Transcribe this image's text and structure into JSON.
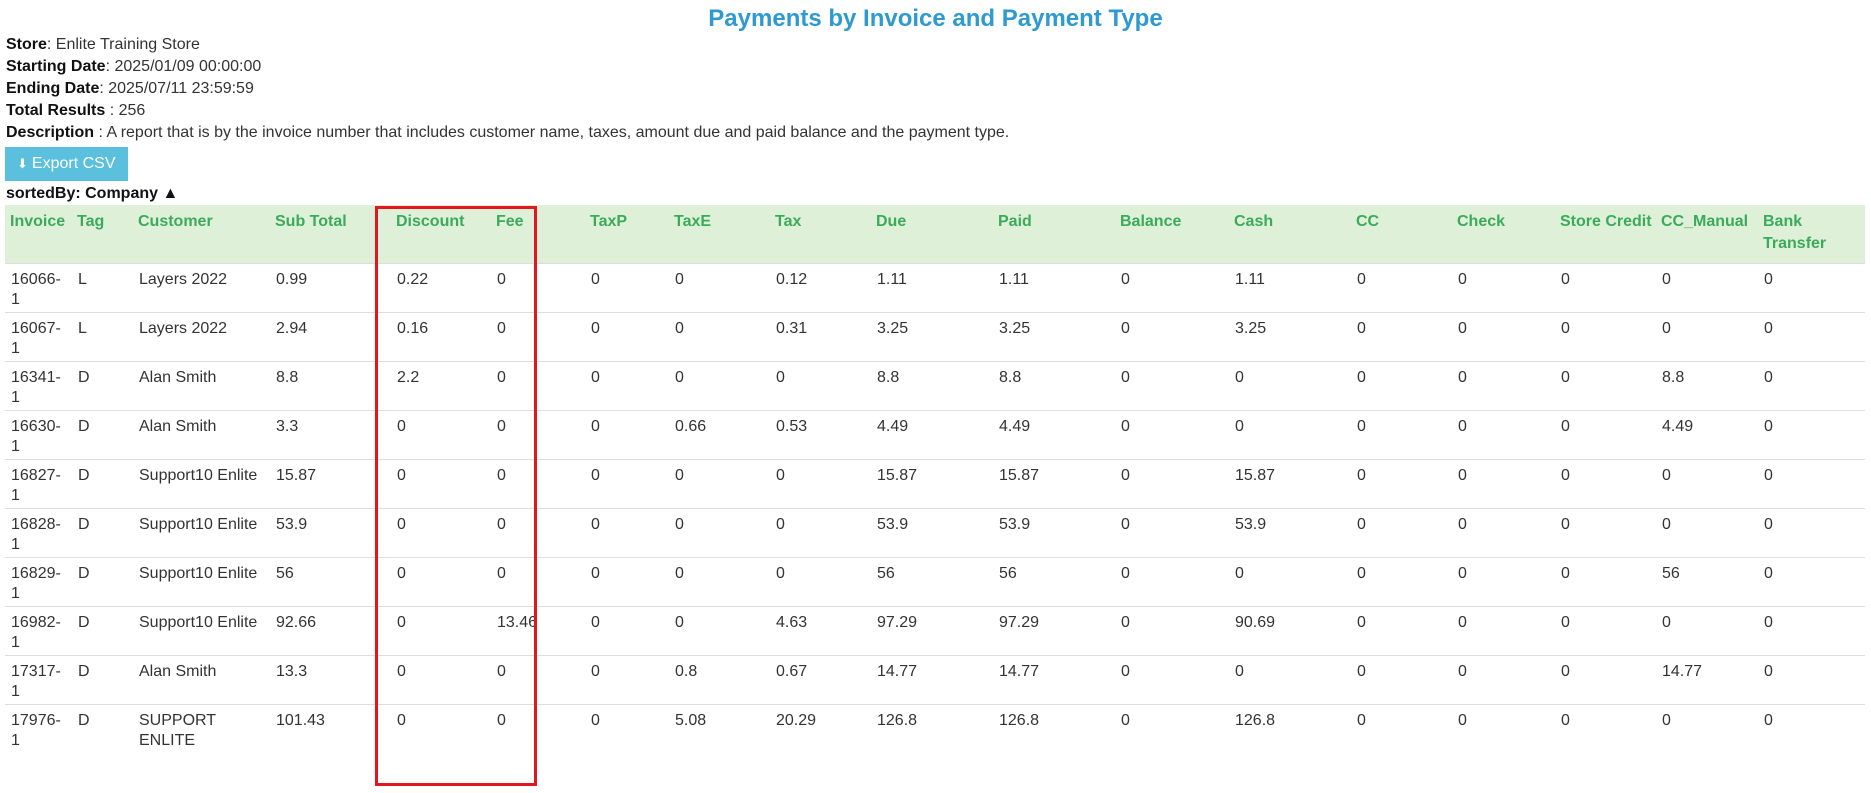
{
  "report": {
    "title": "Payments by Invoice and Payment Type",
    "store_label": "Store",
    "store_value": ": Enlite Training Store",
    "start_label": "Starting Date",
    "start_value": ": 2025/01/09 00:00:00",
    "end_label": "Ending Date",
    "end_value": ": 2025/07/11 23:59:59",
    "total_label": "Total Results",
    "total_value": " : 256",
    "desc_label": "Description",
    "desc_value": " : A report that is by the invoice number that includes customer name, taxes, amount due and paid balance and the payment type.",
    "export_label": "Export CSV",
    "export_icon": "download-icon",
    "sorted_by": "sortedBy: Company ▲"
  },
  "colors": {
    "title": "#2e9ad0",
    "header_bg": "#dff0d8",
    "header_text": "#3aab5b",
    "button": "#5bc0de",
    "highlight": "#e3151f"
  },
  "table": {
    "columns": [
      "Invoice",
      "Tag",
      "Customer",
      "Sub Total",
      "Discount",
      "Fee",
      "TaxP",
      "TaxE",
      "Tax",
      "Due",
      "Paid",
      "Balance",
      "Cash",
      "CC",
      "Check",
      "Store Credit",
      "CC_Manual",
      "Bank Transfer"
    ],
    "rows": [
      [
        "16066-1",
        "L",
        "Layers 2022",
        "0.99",
        "0.22",
        "0",
        "0",
        "0",
        "0.12",
        "1.11",
        "1.11",
        "0",
        "1.11",
        "0",
        "0",
        "0",
        "0",
        "0"
      ],
      [
        "16067-1",
        "L",
        "Layers 2022",
        "2.94",
        "0.16",
        "0",
        "0",
        "0",
        "0.31",
        "3.25",
        "3.25",
        "0",
        "3.25",
        "0",
        "0",
        "0",
        "0",
        "0"
      ],
      [
        "16341-1",
        "D",
        "Alan Smith",
        "8.8",
        "2.2",
        "0",
        "0",
        "0",
        "0",
        "8.8",
        "8.8",
        "0",
        "0",
        "0",
        "0",
        "0",
        "8.8",
        "0"
      ],
      [
        "16630-1",
        "D",
        "Alan Smith",
        "3.3",
        "0",
        "0",
        "0",
        "0.66",
        "0.53",
        "4.49",
        "4.49",
        "0",
        "0",
        "0",
        "0",
        "0",
        "4.49",
        "0"
      ],
      [
        "16827-1",
        "D",
        "Support10 Enlite",
        "15.87",
        "0",
        "0",
        "0",
        "0",
        "0",
        "15.87",
        "15.87",
        "0",
        "15.87",
        "0",
        "0",
        "0",
        "0",
        "0"
      ],
      [
        "16828-1",
        "D",
        "Support10 Enlite",
        "53.9",
        "0",
        "0",
        "0",
        "0",
        "0",
        "53.9",
        "53.9",
        "0",
        "53.9",
        "0",
        "0",
        "0",
        "0",
        "0"
      ],
      [
        "16829-1",
        "D",
        "Support10 Enlite",
        "56",
        "0",
        "0",
        "0",
        "0",
        "0",
        "56",
        "56",
        "0",
        "0",
        "0",
        "0",
        "0",
        "56",
        "0"
      ],
      [
        "16982-1",
        "D",
        "Support10 Enlite",
        "92.66",
        "0",
        "13.46",
        "0",
        "0",
        "4.63",
        "97.29",
        "97.29",
        "0",
        "90.69",
        "0",
        "0",
        "0",
        "0",
        "0"
      ],
      [
        "17317-1",
        "D",
        "Alan Smith",
        "13.3",
        "0",
        "0",
        "0",
        "0.8",
        "0.67",
        "14.77",
        "14.77",
        "0",
        "0",
        "0",
        "0",
        "0",
        "14.77",
        "0"
      ],
      [
        "17976-1",
        "D",
        "SUPPORT ENLITE",
        "101.43",
        "0",
        "0",
        "0",
        "5.08",
        "20.29",
        "126.8",
        "126.8",
        "0",
        "126.8",
        "0",
        "0",
        "0",
        "0",
        "0"
      ]
    ]
  }
}
